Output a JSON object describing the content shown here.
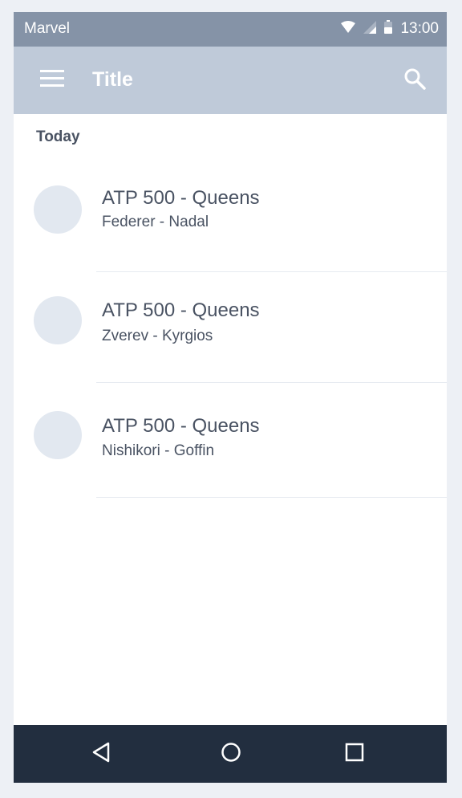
{
  "status_bar": {
    "carrier": "Marvel",
    "time": "13:00",
    "icons": [
      "wifi-icon",
      "signal-icon",
      "battery-icon"
    ]
  },
  "app_bar": {
    "title": "Title",
    "menu_icon": "menu-icon",
    "search_icon": "search-icon"
  },
  "list": {
    "section_header": "Today",
    "items": [
      {
        "title": "ATP 500 - Queens",
        "subtitle": "Federer - Nadal"
      },
      {
        "title": "ATP 500 - Queens",
        "subtitle": "Zverev - Kyrgios"
      },
      {
        "title": "ATP 500 - Queens",
        "subtitle": "Nishikori - Goffin"
      }
    ]
  },
  "nav_bar": {
    "icons": [
      "back-icon",
      "home-icon",
      "recents-icon"
    ]
  },
  "colors": {
    "status_bar": "#8593a7",
    "app_bar": "#bfcad9",
    "nav_bar": "#222e3f",
    "text": "#4a5363",
    "avatar": "#e2e8f0",
    "page_background": "#edf0f5"
  }
}
